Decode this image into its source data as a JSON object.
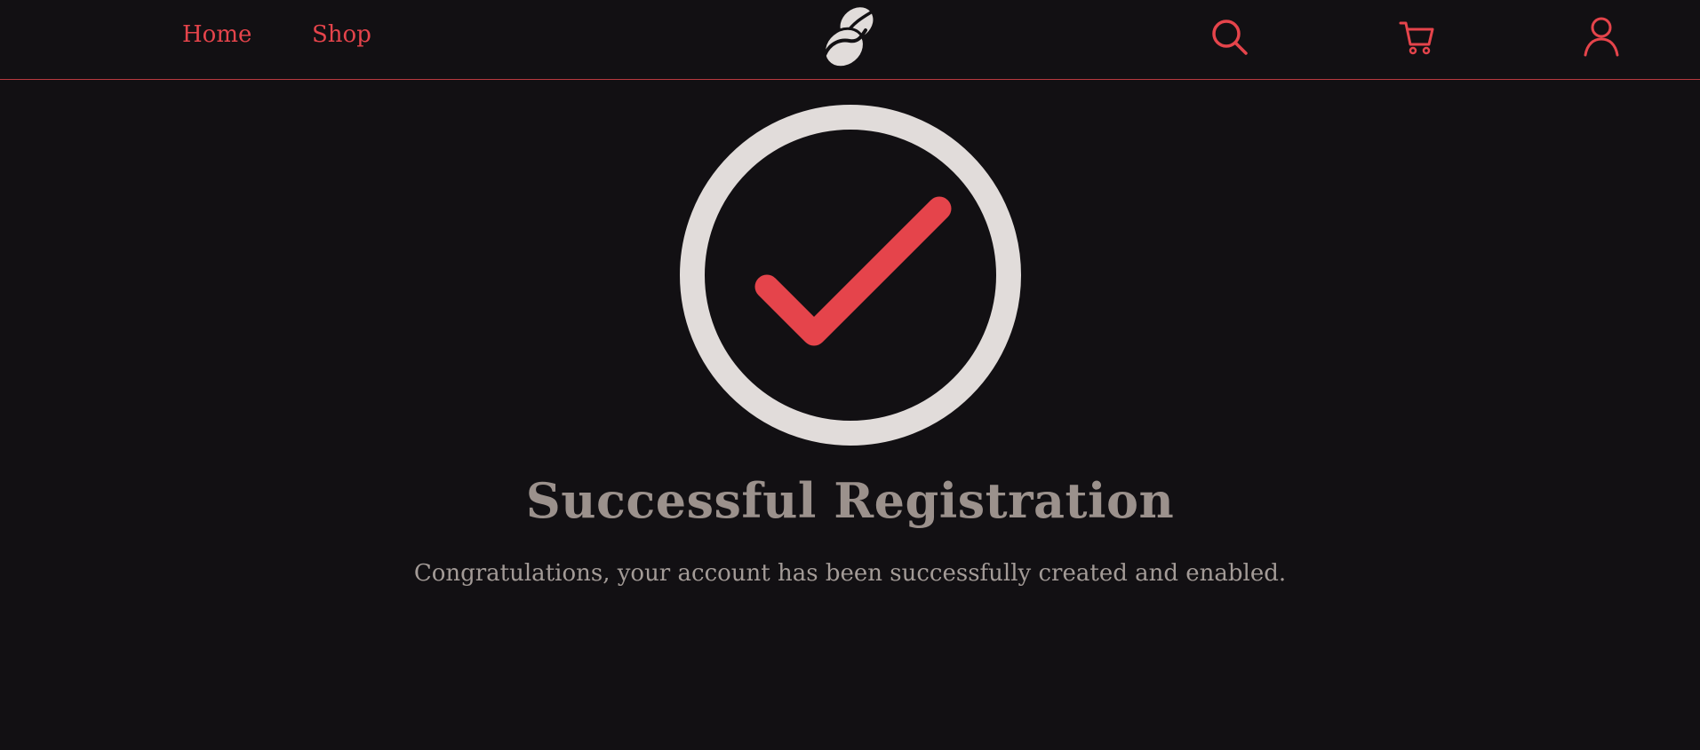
{
  "nav": {
    "home_label": "Home",
    "shop_label": "Shop",
    "logo_icon": "coffee-beans-icon",
    "search_icon": "search-icon",
    "cart_icon": "cart-icon",
    "account_icon": "user-icon"
  },
  "main": {
    "status_icon": "check-circle-icon",
    "title": "Successful Registration",
    "message": "Congratulations, your account has been successfully created and enabled."
  },
  "colors": {
    "background": "#121013",
    "accent": "#e5444b",
    "circle": "#e1dcda",
    "title": "#9b918c",
    "text": "#a39b97"
  }
}
